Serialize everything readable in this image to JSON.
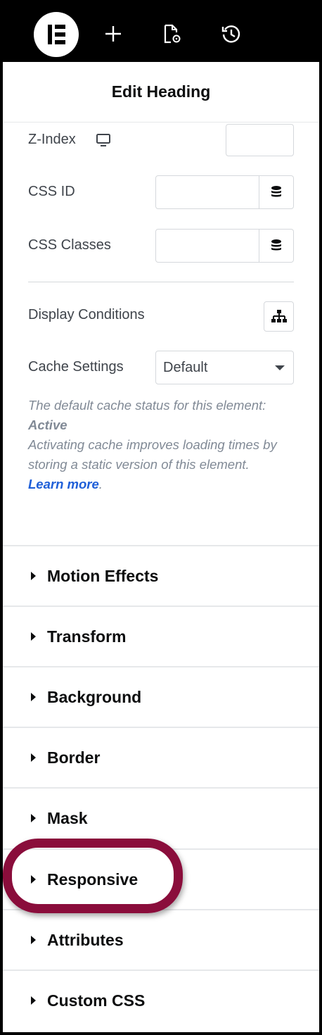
{
  "toolbar": {
    "icons": [
      "elementor-logo-icon",
      "add-icon",
      "page-settings-icon",
      "history-icon"
    ]
  },
  "header": {
    "title": "Edit Heading"
  },
  "fields": {
    "z_index": {
      "label": "Z-Index",
      "icon": "desktop-icon",
      "value": ""
    },
    "css_id": {
      "label": "CSS ID",
      "value": ""
    },
    "css_classes": {
      "label": "CSS Classes",
      "value": ""
    },
    "display_conditions": {
      "label": "Display Conditions"
    },
    "cache_settings": {
      "label": "Cache Settings",
      "selected": "Default"
    }
  },
  "note": {
    "line1": "The default cache status for this element:",
    "status": "Active",
    "line2": "Activating cache improves loading times by storing a static version of this element.",
    "link": "Learn more",
    "tail": "."
  },
  "sections": [
    {
      "title": "Motion Effects"
    },
    {
      "title": "Transform"
    },
    {
      "title": "Background"
    },
    {
      "title": "Border"
    },
    {
      "title": "Mask"
    },
    {
      "title": "Responsive"
    },
    {
      "title": "Attributes"
    },
    {
      "title": "Custom CSS"
    }
  ],
  "colors": {
    "highlight": "#8a0d3b",
    "link": "#1f5fd8",
    "toolbar": "#000000"
  }
}
